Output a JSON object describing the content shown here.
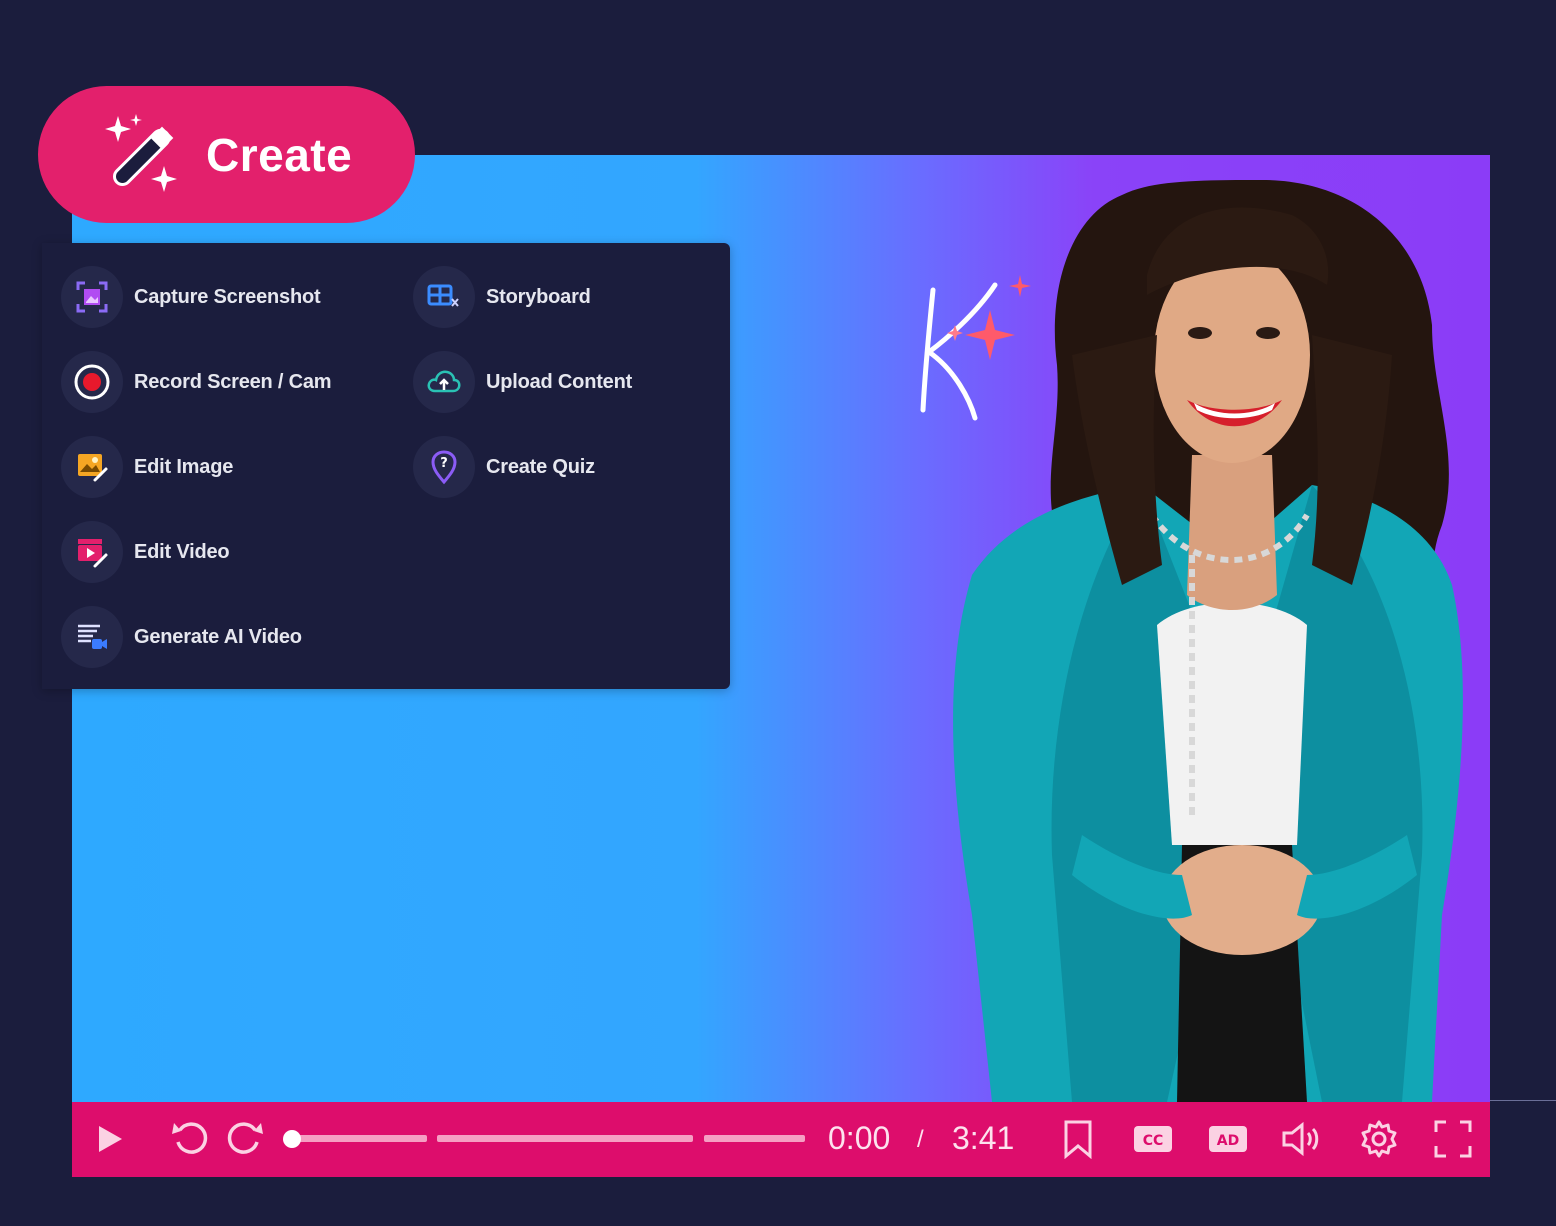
{
  "create_button": {
    "label": "Create",
    "icon": "magic-wand-icon"
  },
  "menu": {
    "left_items": [
      {
        "label": "Capture Screenshot",
        "icon": "capture-screenshot-icon"
      },
      {
        "label": "Record Screen / Cam",
        "icon": "record-icon"
      },
      {
        "label": "Edit Image",
        "icon": "edit-image-icon"
      },
      {
        "label": "Edit Video",
        "icon": "edit-video-icon"
      },
      {
        "label": "Generate AI Video",
        "icon": "ai-video-icon"
      }
    ],
    "right_items": [
      {
        "label": "Storyboard",
        "icon": "storyboard-icon"
      },
      {
        "label": "Upload Content",
        "icon": "cloud-upload-icon"
      },
      {
        "label": "Create Quiz",
        "icon": "quiz-icon"
      }
    ]
  },
  "player": {
    "current_time": "0:00",
    "separator": "/",
    "duration": "3:41",
    "progress": 0.0,
    "colors": {
      "bar": "#dd0d6c",
      "accent": "#e3206c",
      "stage_left": "#2ea9ff",
      "stage_right": "#8b3cf7"
    }
  }
}
